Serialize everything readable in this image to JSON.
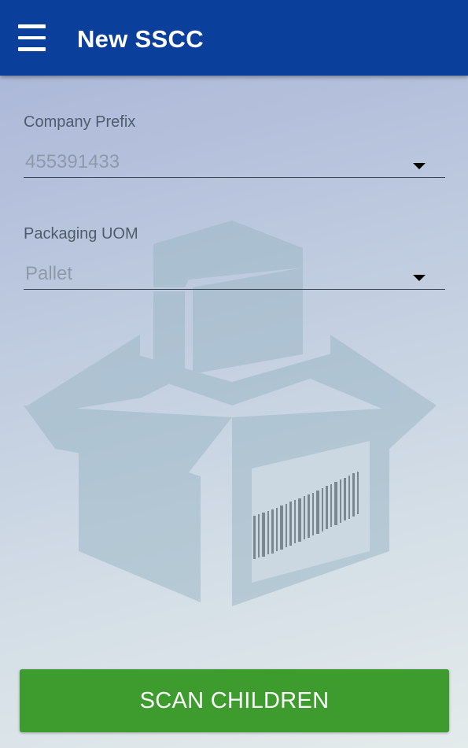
{
  "appbar": {
    "title": "New SSCC",
    "menu_icon": "hamburger-menu-icon",
    "color": "#0a3f9c"
  },
  "form": {
    "company_prefix": {
      "label": "Company Prefix",
      "value": "455391433"
    },
    "packaging_uom": {
      "label": "Packaging UOM",
      "value": "Pallet"
    }
  },
  "background": {
    "icon": "open-box-barcode-icon"
  },
  "actions": {
    "scan_label": "SCAN CHILDREN",
    "scan_color": "#3e9b2e"
  }
}
